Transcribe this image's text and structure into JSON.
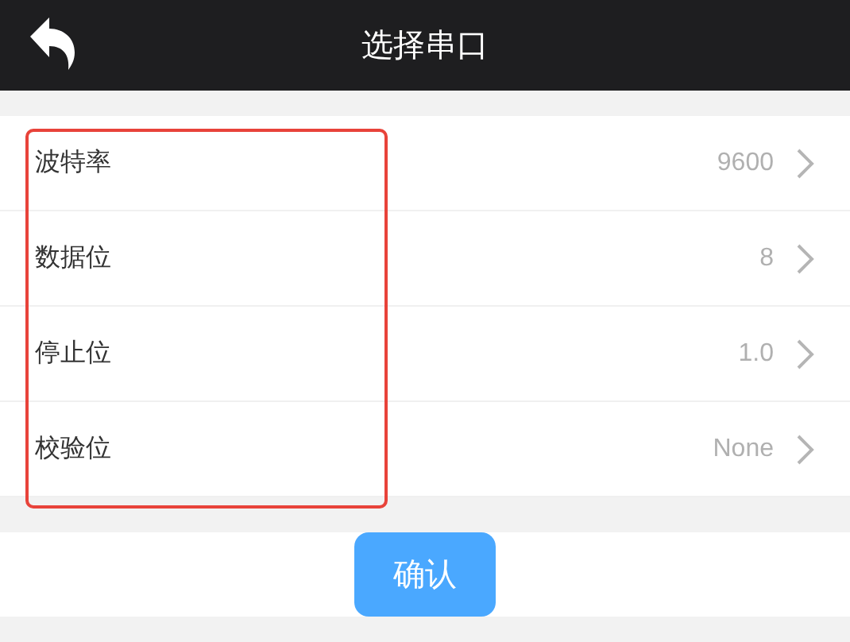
{
  "header": {
    "title": "选择串口"
  },
  "settings": [
    {
      "label": "波特率",
      "value": "9600"
    },
    {
      "label": "数据位",
      "value": "8"
    },
    {
      "label": "停止位",
      "value": "1.0"
    },
    {
      "label": "校验位",
      "value": "None"
    }
  ],
  "confirm_button": "确认"
}
